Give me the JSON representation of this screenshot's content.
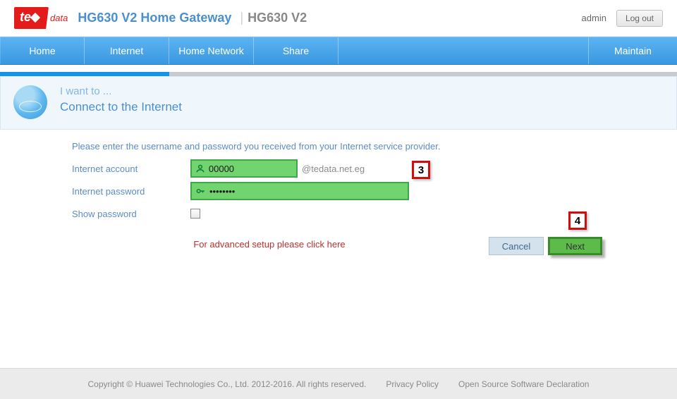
{
  "logo": {
    "part1": "te",
    "part2": "data"
  },
  "header": {
    "title": "HG630 V2 Home Gateway",
    "subtitle": "HG630 V2",
    "user": "admin",
    "logout": "Log out"
  },
  "nav": {
    "items": [
      "Home",
      "Internet",
      "Home Network",
      "Share"
    ],
    "right": "Maintain"
  },
  "wizard": {
    "lead": "I want to ...",
    "title": "Connect to the Internet",
    "instruction": "Please enter the username and password you received from your Internet service provider.",
    "account_label": "Internet account",
    "account_value": "00000",
    "account_suffix": "@tedata.net.eg",
    "password_label": "Internet password",
    "password_value": "••••••••",
    "show_label": "Show password",
    "advanced": "For advanced setup please click here",
    "cancel": "Cancel",
    "next": "Next"
  },
  "annotations": {
    "three": "3",
    "four": "4"
  },
  "footer": {
    "copyright": "Copyright © Huawei Technologies Co., Ltd. 2012-2016. All rights reserved.",
    "privacy": "Privacy Policy",
    "oss": "Open Source Software Declaration"
  }
}
